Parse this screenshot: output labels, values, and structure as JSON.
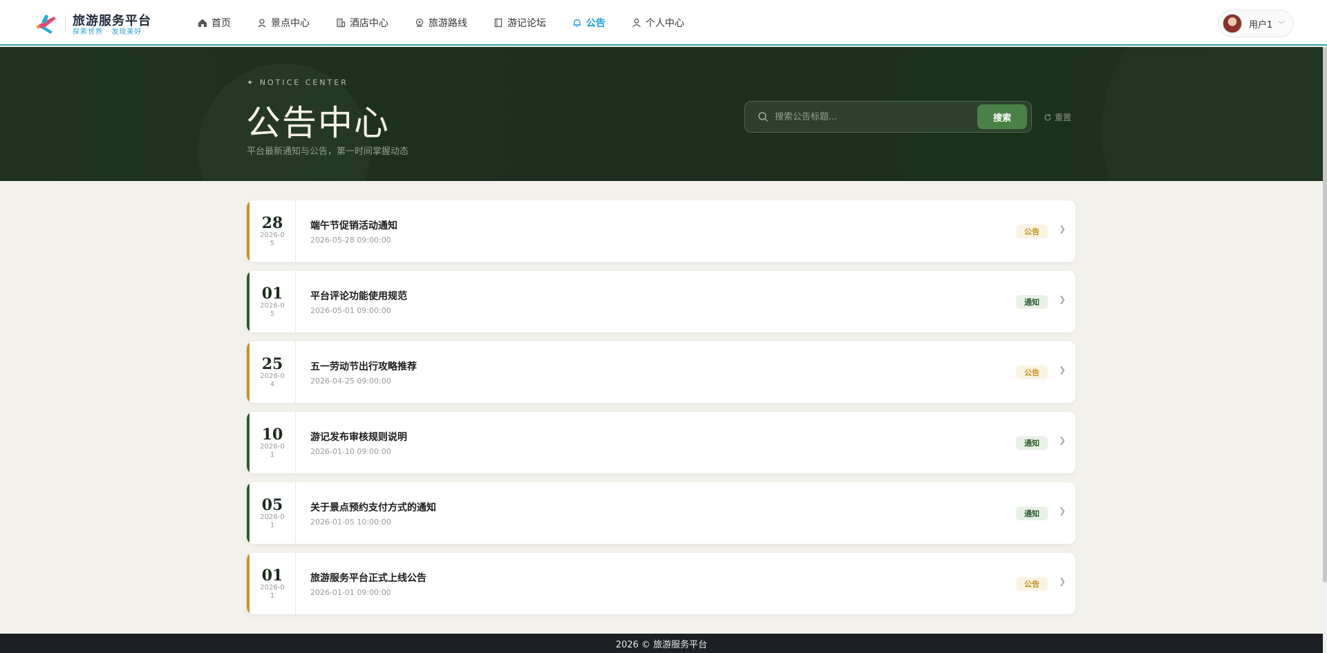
{
  "brand": {
    "name": "旅游服务平台",
    "slogan": "探索世界 · 发现美好"
  },
  "nav": {
    "items": [
      {
        "label": "首页",
        "icon": "home-icon",
        "active": false
      },
      {
        "label": "景点中心",
        "icon": "map-pin-icon",
        "active": false
      },
      {
        "label": "酒店中心",
        "icon": "building-icon",
        "active": false
      },
      {
        "label": "旅游路线",
        "icon": "route-icon",
        "active": false
      },
      {
        "label": "游记论坛",
        "icon": "book-icon",
        "active": false
      },
      {
        "label": "公告",
        "icon": "bell-icon",
        "active": true
      },
      {
        "label": "个人中心",
        "icon": "user-icon",
        "active": false
      }
    ]
  },
  "user": {
    "name": "用户1"
  },
  "hero": {
    "tag": "✦ NOTICE CENTER",
    "title": "公告中心",
    "subtitle": "平台最新通知与公告，第一时间掌握动态",
    "search_placeholder": "搜索公告标题...",
    "search_label": "搜索",
    "reset_label": "重置"
  },
  "notices": [
    {
      "day": "28",
      "ym": "2026-05",
      "title": "端午节促销活动通知",
      "time": "2026-05-28 09:00:00",
      "type": "公告",
      "style": "gold"
    },
    {
      "day": "01",
      "ym": "2026-05",
      "title": "平台评论功能使用规范",
      "time": "2026-05-01 09:00:00",
      "type": "通知",
      "style": "green"
    },
    {
      "day": "25",
      "ym": "2026-04",
      "title": "五一劳动节出行攻略推荐",
      "time": "2026-04-25 09:00:00",
      "type": "公告",
      "style": "gold"
    },
    {
      "day": "10",
      "ym": "2026-01",
      "title": "游记发布审核规则说明",
      "time": "2026-01-10 09:00:00",
      "type": "通知",
      "style": "green"
    },
    {
      "day": "05",
      "ym": "2026-01",
      "title": "关于景点预约支付方式的通知",
      "time": "2026-01-05 10:00:00",
      "type": "通知",
      "style": "green"
    },
    {
      "day": "01",
      "ym": "2026-01",
      "title": "旅游服务平台正式上线公告",
      "time": "2026-01-01 09:00:00",
      "type": "公告",
      "style": "gold"
    }
  ],
  "footer": {
    "text": "2026 © 旅游服务平台"
  },
  "colors": {
    "accent": "#1a9cd6",
    "hero_bg": "#1f3320",
    "search_button": "#4a8146",
    "notice_gold": "#c98f22",
    "notice_green": "#2d5a2d"
  }
}
